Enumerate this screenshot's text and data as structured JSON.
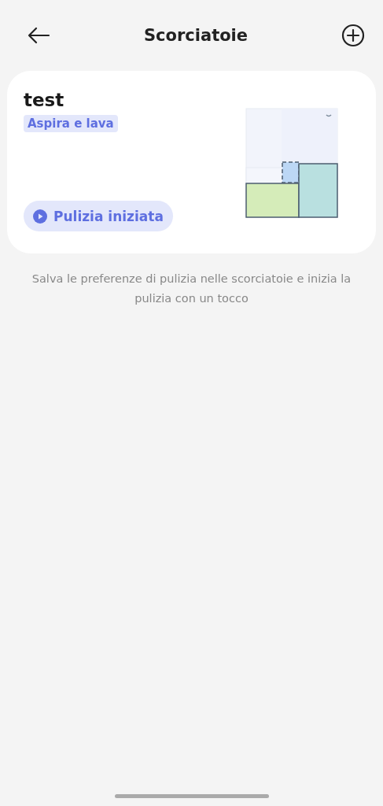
{
  "header": {
    "title": "Scorciatoie"
  },
  "shortcuts": [
    {
      "name": "test",
      "mode": "Aspira e lava",
      "action": "Pulizia iniziata"
    }
  ],
  "description": "Salva le preferenze di pulizia nelle scorciatoie e inizia la pulizia con un tocco"
}
